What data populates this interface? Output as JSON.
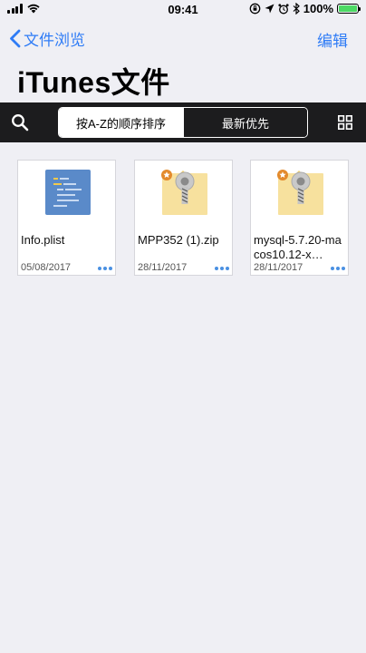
{
  "status_bar": {
    "time": "09:41",
    "battery_percent": "100%",
    "battery_level": 1.0
  },
  "nav": {
    "back_label": "文件浏览",
    "edit_label": "编辑"
  },
  "title": "iTunes文件",
  "toolbar": {
    "sort_options": [
      "按A-Z的顺序排序",
      "最新优先"
    ],
    "selected_sort": "按A-Z的顺序排序"
  },
  "files": [
    {
      "name": "Info.plist",
      "date": "05/08/2017",
      "icon": "plist-file-icon"
    },
    {
      "name": "MPP352 (1).zip",
      "date": "28/11/2017",
      "icon": "zip-archive-icon",
      "starred": true
    },
    {
      "name": "mysql-5.7.20-macos10.12-x…",
      "date": "28/11/2017",
      "icon": "zip-archive-icon",
      "starred": true
    }
  ],
  "colors": {
    "accent": "#2f7cf6",
    "toolbar_bg": "#1c1c1e",
    "page_bg": "#efeff4"
  }
}
